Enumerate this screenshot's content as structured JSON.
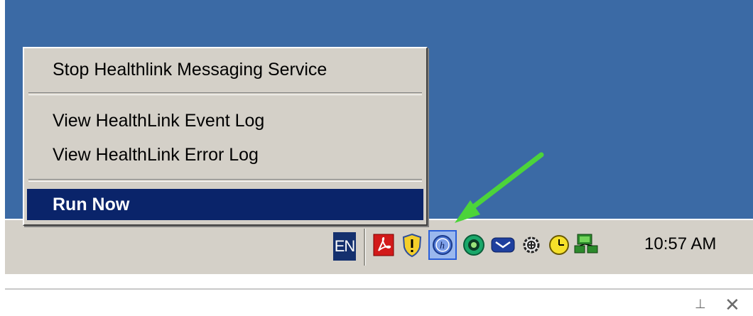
{
  "context_menu": {
    "items": [
      {
        "label": "Stop Healthlink Messaging Service"
      },
      {
        "label": "View HealthLink Event Log"
      },
      {
        "label": "View HealthLink Error Log"
      },
      {
        "label": "Run Now",
        "selected": true
      }
    ]
  },
  "taskbar": {
    "language": "EN",
    "clock": "10:57 AM",
    "tray_icons": [
      "adobe-acrobat-icon",
      "security-shield-icon",
      "healthlink-icon",
      "green-circle-icon",
      "mail-icon",
      "gear-icon",
      "clock-icon",
      "network-icon"
    ]
  },
  "colors": {
    "desktop": "#3b6aa5",
    "menu_highlight": "#0a246a",
    "arrow": "#4cd43a"
  }
}
